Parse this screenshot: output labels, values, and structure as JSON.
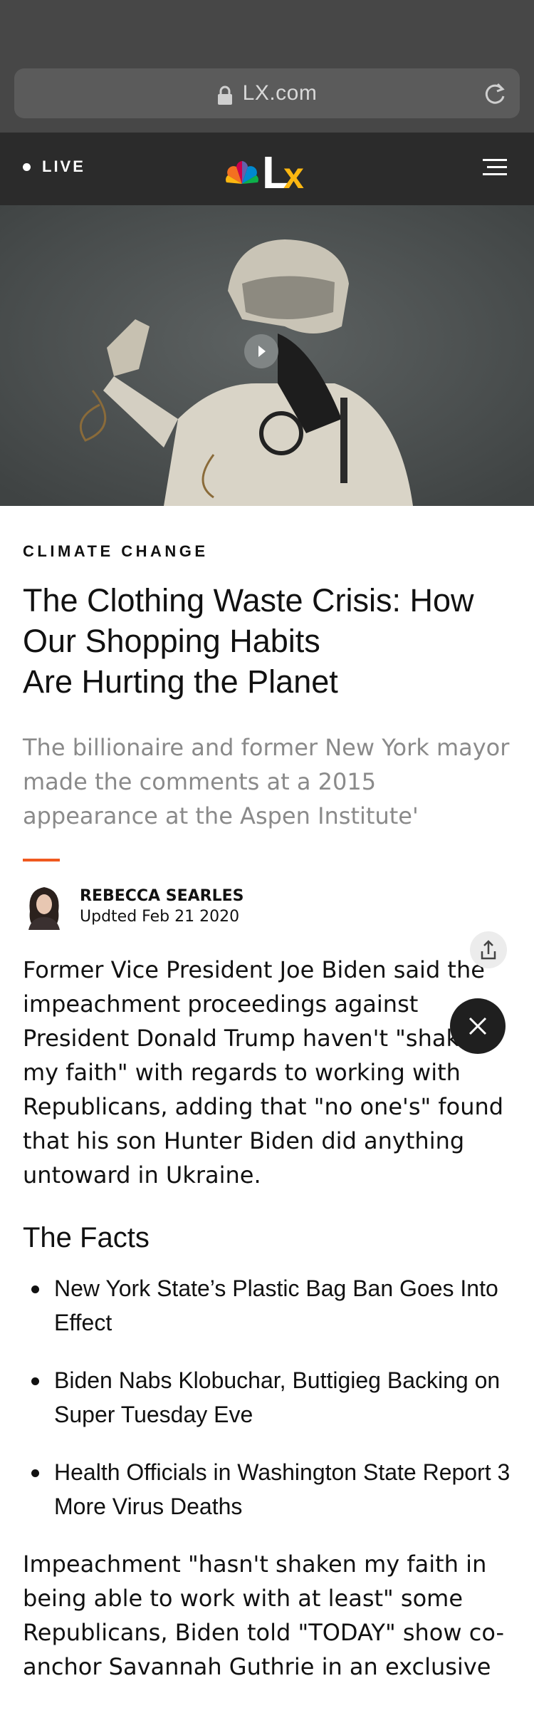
{
  "browser": {
    "url": "LX.com"
  },
  "header": {
    "live_label": "LIVE",
    "logo_text": "LX"
  },
  "article": {
    "kicker": "CLIMATE CHANGE",
    "headline_lines": [
      "The Clothing Waste Crisis: How",
      "Our Shopping Habits",
      "Are Hurting the Planet"
    ],
    "dek": "The billionaire and former New York mayor made the comments at a 2015 appearance at the Aspen Institute'",
    "author": "REBECCA SEARLES",
    "date": "Updted Feb 21 2020",
    "paragraph_1": "Former Vice President Joe Biden said the impeachment proceedings against President Donald Trump haven't \"shaken my faith\" with regards to working with Republicans, adding that \"no one's\" found that his son Hunter Biden did anything untoward in Ukraine.",
    "facts_title": "The Facts",
    "facts": [
      "New York State’s Plastic Bag Ban Goes Into Effect",
      "Biden Nabs Klobuchar, Buttigieg Backing on Super Tuesday Eve",
      "Health Officials in Washington State Report 3 More Virus Deaths"
    ],
    "paragraph_2": "Impeachment \"hasn't shaken my faith in being able to work with at least\" some Republicans, Biden told \"TODAY\" show co-anchor Savannah Guthrie in an exclusive"
  },
  "colors": {
    "accent": "#f0591f",
    "header_bg": "#2b2b2b",
    "browser_bg": "#474747"
  },
  "icons": [
    "lock-icon",
    "reload-icon",
    "nbc-peacock-icon",
    "menu-icon",
    "play-icon",
    "share-icon",
    "close-icon"
  ]
}
